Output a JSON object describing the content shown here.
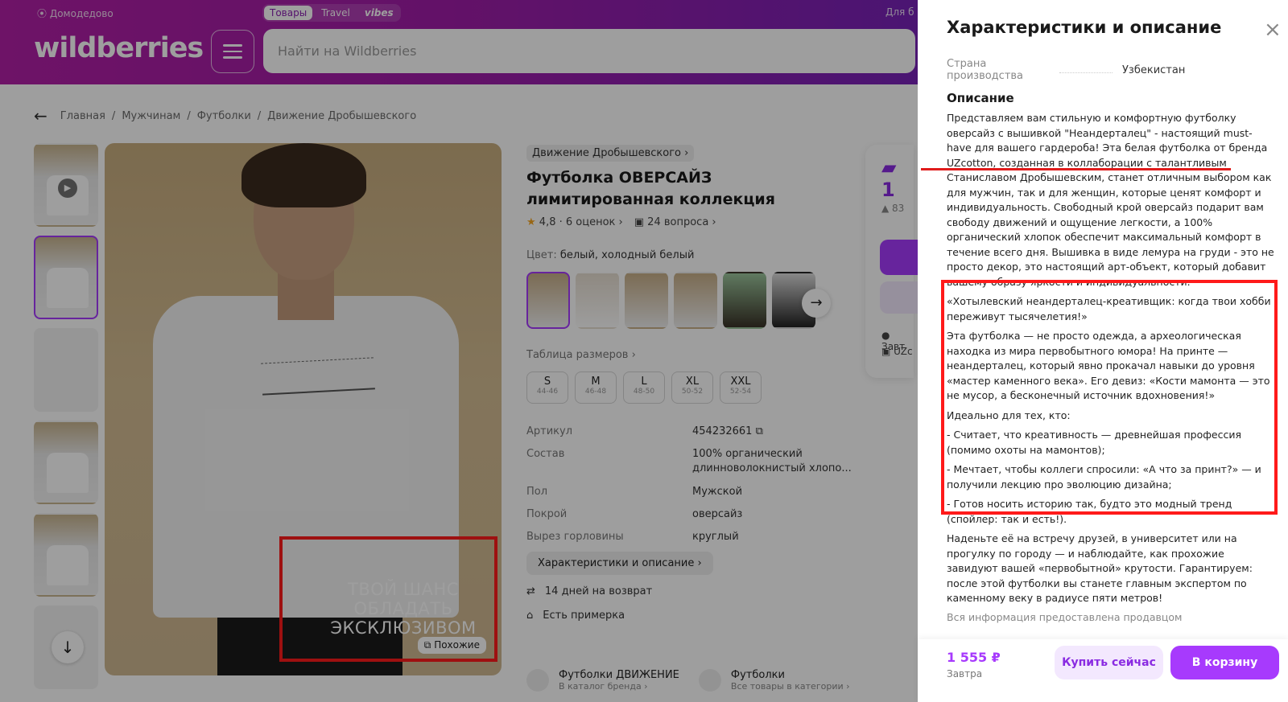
{
  "header": {
    "location": "Домодедово",
    "tabs": [
      "Товары",
      "Travel",
      "vibes"
    ],
    "for_business": "Для б",
    "logo": "wildberries",
    "search_placeholder": "Найти на Wildberries"
  },
  "breadcrumb": [
    "Главная",
    "Мужчинам",
    "Футболки",
    "Движение Дробышевского"
  ],
  "product": {
    "brand": "Движение Дробышевского",
    "title": "Футболка ОВЕРСАЙЗ лимитированная коллекция",
    "rating": "4,8",
    "reviews": "6 оценок",
    "questions": "24 вопроса",
    "color_label": "Цвет:",
    "color_value": "белый, холодный белый",
    "size_table_label": "Таблица размеров",
    "sizes": [
      {
        "s": "S",
        "r": "44-46"
      },
      {
        "s": "M",
        "r": "46-48"
      },
      {
        "s": "L",
        "r": "48-50"
      },
      {
        "s": "XL",
        "r": "50-52"
      },
      {
        "s": "XXL",
        "r": "52-54"
      }
    ],
    "params": [
      {
        "k": "Артикул",
        "v": "454232661"
      },
      {
        "k": "Состав",
        "v": "100% органический длинноволокнистый хлопо..."
      },
      {
        "k": "Пол",
        "v": "Мужской"
      },
      {
        "k": "Покрой",
        "v": "оверсайз"
      },
      {
        "k": "Вырез горловины",
        "v": "круглый"
      }
    ],
    "spec_button": "Характеристики и описание",
    "return": "14 дней на возврат",
    "fitting": "Есть примерка",
    "promo_text": "ТВОЙ ШАНС ОБЛАДАТЬ ЭКСКЛЮЗИВОМ",
    "similar_button": "Похожие",
    "card1": {
      "title": "Футболки ДВИЖЕНИЕ",
      "sub": "В каталог бренда"
    },
    "card2": {
      "title": "Футболки",
      "sub": "Все товары в категории"
    },
    "peek_price": "1",
    "peek_rating": "83",
    "peek_delivery": "Завт",
    "peek_seller": "UZc"
  },
  "panel": {
    "title": "Характеристики и описание",
    "country_label": "Страна производства",
    "country_value": "Узбекистан",
    "desc_heading": "Описание",
    "paragraphs": [
      "Представляем вам стильную и комфортную футболку оверсайз с вышивкой \"Неандерталец\" - настоящий must-have для вашего гардероба! Эта белая футболка от бренда UZcotton, созданная в коллаборации с талантливым Станиславом Дробышевским, станет отличным выбором как для мужчин, так и для женщин, которые ценят комфорт и индивидуальность. Свободный крой оверсайз подарит вам свободу движений и ощущение легкости, а 100% органический хлопок обеспечит максимальный комфорт в течение всего дня. Вышивка в виде лемура на груди - это не просто декор, это настоящий арт-объект, который добавит вашему образу яркости и индивидуальности.",
      "«Хотылевский неандерталец-креативщик: когда твои хобби переживут тысячелетия!»",
      "Эта футболка — не просто одежда, а археологическая находка из мира первобытного юмора! На принте — неандерталец, который явно прокачал навыки до уровня «мастер каменного века». Его девиз: «Кости мамонта — это не мусор, а бесконечный источник вдохновения!»",
      "Идеально для тех, кто:",
      "- Считает, что креативность — древнейшая профессия (помимо охоты на мамонтов);",
      "- Мечтает, чтобы коллеги спросили: «А что за принт?» — и получили лекцию про эволюцию дизайна;",
      "- Готов носить историю так, будто это модный тренд (спойлер: так и есть!).",
      "Наденьте её на встречу друзей, в университет или на прогулку по городу — и наблюдайте, как прохожие завидуют вашей «первобытной» крутости. Гарантируем: после этой футболки вы станете главным экспертом по каменному веку в радиусе пяти метров!"
    ],
    "seller_note": "Вся информация предоставлена продавцом",
    "price": "1 555 ₽",
    "date": "Завтра",
    "buy_now": "Купить сейчас",
    "to_cart": "В корзину"
  }
}
